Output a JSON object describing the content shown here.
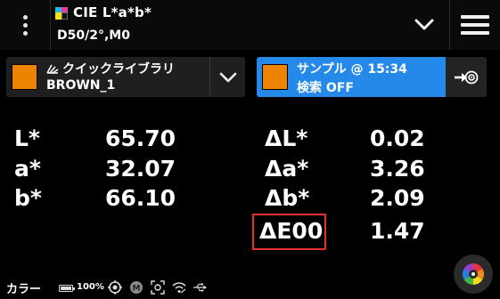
{
  "header": {
    "mode_title": "CIE L*a*b*",
    "mode_subtitle": "D50/2°,M0",
    "menu_icon": "kebab-menu-icon",
    "dropdown_icon": "chevron-down-icon",
    "hamburger_icon": "hamburger-menu-icon"
  },
  "library": {
    "title": "クイックライブラリ",
    "name": "BROWN_1",
    "swatch_color": "#EE8300"
  },
  "sample": {
    "title": "サンプル @ 15:34",
    "search": "検索 OFF",
    "swatch_color": "#EE8300",
    "accent_color": "#2489E9"
  },
  "values": {
    "L_label": "L*",
    "L": "65.70",
    "a_label": "a*",
    "a": "32.07",
    "b_label": "b*",
    "b": "66.10"
  },
  "deltas": {
    "dL_label": "ΔL*",
    "dL": "0.02",
    "da_label": "Δa*",
    "da": "3.26",
    "db_label": "Δb*",
    "db": "2.09",
    "dE_label": "ΔE00",
    "dE": "1.47",
    "highlight_color": "#E53030"
  },
  "statusbar": {
    "label": "カラー",
    "battery_text": "100%",
    "battery_level": 1.0
  }
}
